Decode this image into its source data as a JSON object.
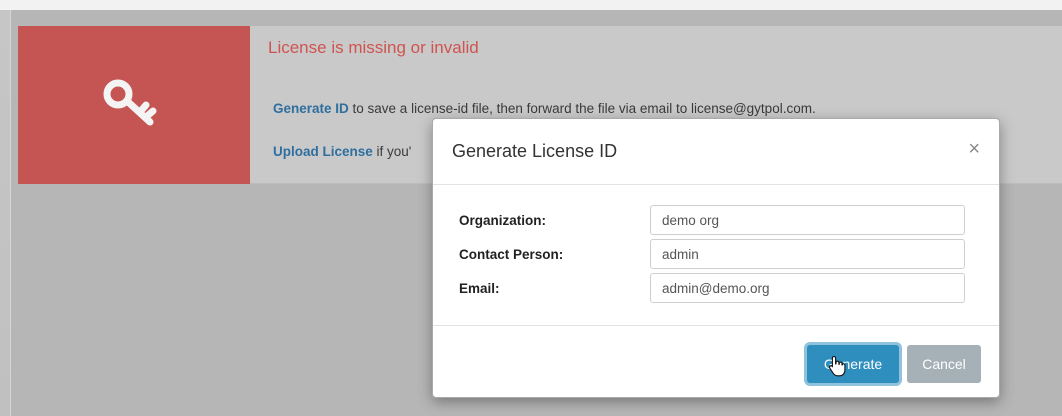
{
  "alert": {
    "title": "License is missing or invalid",
    "line1_link": "Generate ID",
    "line1_text": " to save a license-id file, then forward the file via email to license@gytpol.com.",
    "line2_link": "Upload License",
    "line2_text": " if you'"
  },
  "modal": {
    "title": "Generate License ID",
    "close": "×",
    "fields": [
      {
        "label": "Organization:",
        "value": "demo org"
      },
      {
        "label": "Contact Person:",
        "value": "admin"
      },
      {
        "label": "Email:",
        "value": "admin@demo.org"
      }
    ],
    "generate_label": "Generate",
    "cancel_label": "Cancel"
  },
  "colors": {
    "alert_accent": "#c55552",
    "link": "#2f6f9e",
    "primary_button": "#2e8fbf",
    "secondary_button": "#a5b0b7"
  },
  "icons": {
    "alert_icon": "key-icon",
    "cursor": "hand-pointer-icon"
  }
}
